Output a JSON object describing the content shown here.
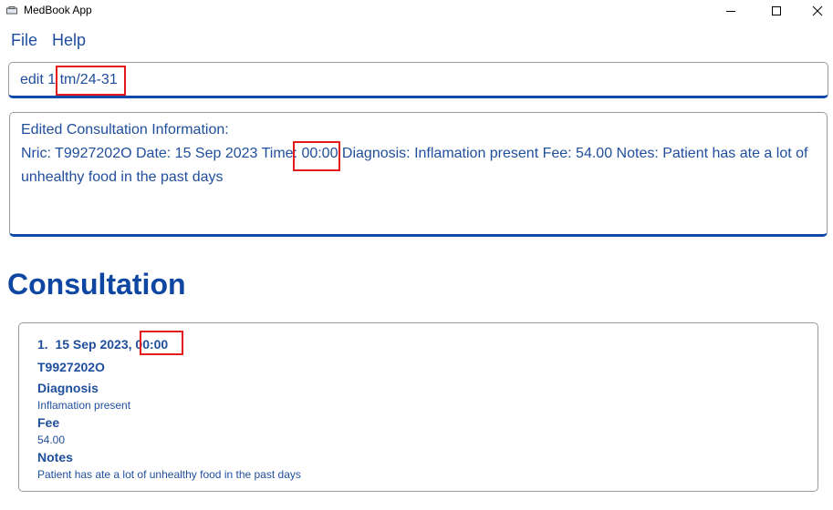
{
  "window": {
    "title": "MedBook App",
    "icon": "app-icon",
    "controls": [
      "minimize-icon",
      "maximize-icon",
      "close-icon"
    ]
  },
  "menu": {
    "items": [
      "File",
      "Help"
    ]
  },
  "command": {
    "value": "edit 1 tm/24-31"
  },
  "result": {
    "line1": "Edited Consultation Information:",
    "line2": "Nric: T9927202O Date: 15 Sep 2023 Time: 00:00 Diagnosis: Inflamation present Fee: 54.00 Notes: Patient has ate a lot of",
    "line3": "unhealthy food in the past days"
  },
  "section": {
    "title": "Consultation"
  },
  "consultation": {
    "header": "1.  15 Sep 2023, 00:00",
    "nric": "T9927202O",
    "diagnosis_label": "Diagnosis",
    "diagnosis_value": "Inflamation present",
    "fee_label": "Fee",
    "fee_value": "54.00",
    "notes_label": "Notes",
    "notes_value": "Patient has ate a lot of unhealthy food in the past days"
  },
  "colors": {
    "accent": "#0d47a1",
    "text": "#1f4e9c",
    "highlight": "#e31b1b"
  }
}
